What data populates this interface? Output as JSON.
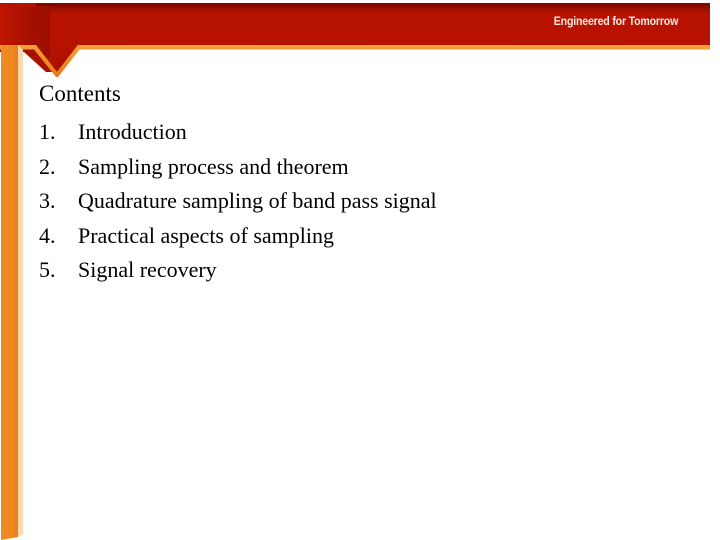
{
  "slide": {
    "tagline": "Engineered for Tomorrow",
    "title": "Contents",
    "items": [
      {
        "number": "1.",
        "label": "Introduction"
      },
      {
        "number": "2.",
        "label": "Sampling process and theorem"
      },
      {
        "number": "3.",
        "label": "Quadrature sampling of band pass signal"
      },
      {
        "number": "4.",
        "label": "Practical aspects of sampling"
      },
      {
        "number": "5.",
        "label": "Signal recovery"
      }
    ]
  },
  "colors": {
    "banner_red_dark": "#8f0d00",
    "banner_red": "#b01100",
    "banner_red_light": "#c21400",
    "accent_orange": "#f0881f",
    "accent_orange_pale": "#fbd9ad",
    "tagline_text": "#ffe8e2",
    "body_text": "#000000",
    "background": "#ffffff"
  }
}
